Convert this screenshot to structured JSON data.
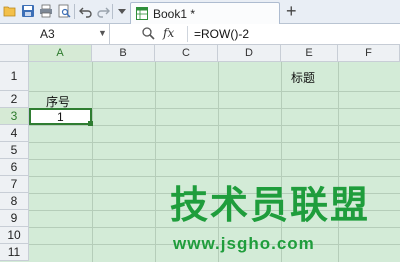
{
  "toolbar": {
    "icons": [
      "open-folder-icon",
      "save-icon",
      "print-icon",
      "print-preview-icon",
      "undo-icon",
      "redo-icon",
      "dropdown-icon"
    ],
    "tab_title": "Book1 *",
    "new_tab": "+"
  },
  "formula_bar": {
    "name_box": "A3",
    "fx_label": "fx",
    "formula": "=ROW()-2"
  },
  "grid": {
    "columns": [
      "A",
      "B",
      "C",
      "D",
      "E",
      "F"
    ],
    "rows": [
      "1",
      "2",
      "3",
      "4",
      "5",
      "6",
      "7",
      "8",
      "9",
      "10",
      "11"
    ],
    "selected_cell": "A3",
    "cells": {
      "E1": "标题",
      "A2": "序号",
      "A3": "1"
    }
  },
  "watermark": {
    "title": "技术员联盟",
    "url": "www.jsgho.com"
  }
}
